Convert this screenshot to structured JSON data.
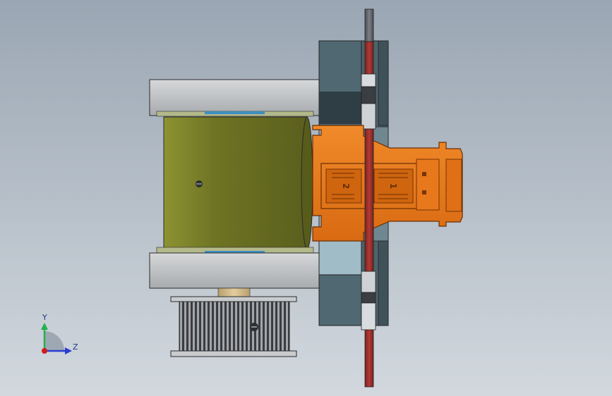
{
  "viewport": {
    "background_top": "#9aa6b3",
    "background_bottom": "#d2d8de"
  },
  "triad": {
    "y_label": "Y",
    "z_label": "Z",
    "y_color": "#22b14c",
    "z_color": "#2a3dd1",
    "origin_color": "#d11a1a"
  },
  "connector": {
    "digit_left": "2",
    "digit_right": "1",
    "body_color": "#e9781a",
    "outline_color": "#6b2e04"
  },
  "colors": {
    "motor_body": "#6e7423",
    "flange": "#c5c7c9",
    "plate_dark": "#3c4e57",
    "plate_light": "#9fbcc7",
    "rod_top": "#6a6e75",
    "rod_bottom": "#a4312d",
    "pulley": "#55585c",
    "shaft": "#d7bf93",
    "bearing_accent": "#3f8fbf"
  }
}
